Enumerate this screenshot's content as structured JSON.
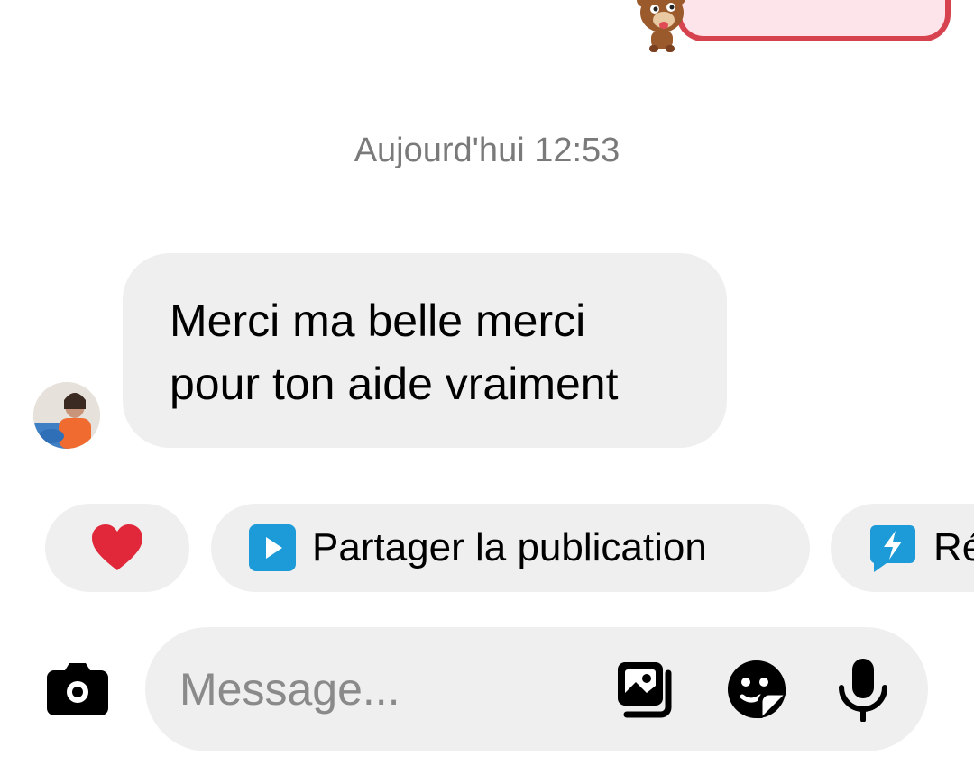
{
  "timestamp": "Aujourd'hui 12:53",
  "message": {
    "lines": [
      "Merci ma belle merci",
      "pour ton aide vraiment"
    ]
  },
  "quick_replies": [
    {
      "icon": "heart-icon",
      "label": ""
    },
    {
      "icon": "play-icon",
      "label": "Partager la publication"
    },
    {
      "icon": "quick-reply-icon",
      "label": "Ré"
    }
  ],
  "composer": {
    "placeholder": "Message..."
  },
  "colors": {
    "bubble_bg": "#efefef",
    "heart": "#e0283a",
    "accent_blue": "#1d9bd8",
    "sticker_red": "#d7424f"
  }
}
